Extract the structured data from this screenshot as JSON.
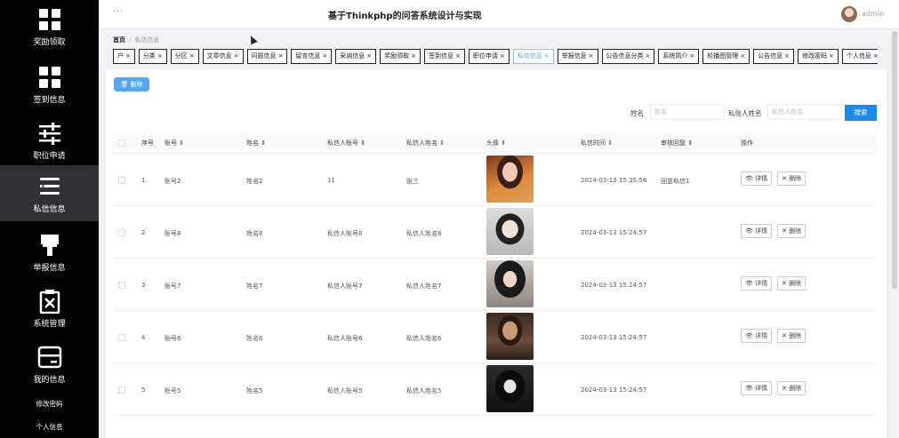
{
  "app": {
    "title": "基于Thinkphp的问答系统设计与实现",
    "user": "admin",
    "menu_dots": "···"
  },
  "sidebar": {
    "items": [
      {
        "label": "奖励领取",
        "icon": "grid-icon"
      },
      {
        "label": "签到信息",
        "icon": "grid-icon"
      },
      {
        "label": "职位申请",
        "icon": "sliders-icon"
      },
      {
        "label": "私信信息",
        "icon": "list-icon"
      },
      {
        "label": "举报信息",
        "icon": "brush-icon"
      },
      {
        "label": "系统管理",
        "icon": "clipboard-x-icon"
      },
      {
        "label": "我的信息",
        "icon": "card-icon"
      }
    ],
    "subitems": [
      "修改密码",
      "个人信息"
    ]
  },
  "breadcrumb": {
    "home": "首页",
    "sep": "/",
    "current": "私信信息"
  },
  "tabs": [
    {
      "label": "户"
    },
    {
      "label": "分类"
    },
    {
      "label": "分区"
    },
    {
      "label": "文章信息"
    },
    {
      "label": "问题信息"
    },
    {
      "label": "留言信息"
    },
    {
      "label": "采纳信息"
    },
    {
      "label": "奖励领取"
    },
    {
      "label": "签到信息"
    },
    {
      "label": "职位申请"
    },
    {
      "label": "私信信息"
    },
    {
      "label": "举报信息"
    },
    {
      "label": "公告信息分类"
    },
    {
      "label": "系统简介"
    },
    {
      "label": "轮播图管理"
    },
    {
      "label": "公告信息"
    },
    {
      "label": "修改密码"
    },
    {
      "label": "个人信息"
    }
  ],
  "tab_close": "×",
  "toolbar": {
    "delete_label": "删除",
    "delete_icon": "trash-icon"
  },
  "search": {
    "name_label": "姓名",
    "name_placeholder": "姓名",
    "rname_label": "私信人姓名",
    "rname_placeholder": "私信人姓名",
    "button": "搜索"
  },
  "table": {
    "headers": [
      "序号",
      "账号 ⇕",
      "姓名 ⇕",
      "私信人账号 ⇕",
      "私信人姓名 ⇕",
      "头像 ⇕",
      "私信时间 ⇕",
      "审核回复 ⇕",
      "操作"
    ],
    "detail_label": "详情",
    "delete_label": "删除",
    "rows": [
      {
        "no": "1",
        "account": "账号2",
        "name": "姓名2",
        "r_account": "11",
        "r_name": "张三",
        "time": "2024-03-13 15:35:56",
        "reply": "回复私信1",
        "photo": "photo-1"
      },
      {
        "no": "2",
        "account": "账号8",
        "name": "姓名8",
        "r_account": "私信人账号8",
        "r_name": "私信人姓名8",
        "time": "2024-03-13 15:24:57",
        "reply": "",
        "photo": "photo-2"
      },
      {
        "no": "3",
        "account": "账号7",
        "name": "姓名7",
        "r_account": "私信人账号7",
        "r_name": "私信人姓名7",
        "time": "2024-03-13 15:24:57",
        "reply": "",
        "photo": "photo-3"
      },
      {
        "no": "4",
        "account": "账号6",
        "name": "姓名6",
        "r_account": "私信人账号6",
        "r_name": "私信人姓名6",
        "time": "2024-03-13 15:24:57",
        "reply": "",
        "photo": "photo-4"
      },
      {
        "no": "5",
        "account": "账号5",
        "name": "姓名5",
        "r_account": "私信人账号5",
        "r_name": "私信人姓名5",
        "time": "2024-03-13 15:24:57",
        "reply": "",
        "photo": "photo-5"
      }
    ]
  },
  "colors": {
    "sidebar": "#020202",
    "accent": "#5aa5f0",
    "search_button": "#1e88e5"
  }
}
